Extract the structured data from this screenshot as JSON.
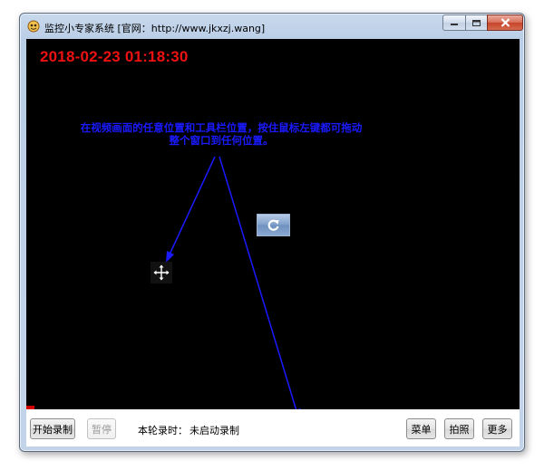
{
  "window": {
    "title": "监控小专家系统 [官网：http://www.jkxzj.wang]",
    "icon": "app-logo-icon",
    "controls": {
      "minimize_icon": "minimize-icon",
      "maximize_icon": "maximize-icon",
      "close_icon": "close-icon"
    }
  },
  "video": {
    "timestamp": "2018-02-23 01:18:30",
    "instruction": "在视频画面的任意位置和工具栏位置，按住鼠标左键都可拖动整个窗口到任何位置。",
    "center_button_icon": "refresh-icon",
    "cursor_icon": "move-icon"
  },
  "toolbar": {
    "start_record_label": "开始录制",
    "pause_label": "暂停",
    "record_time_label": "本轮录时：",
    "record_time_value": "未启动录制",
    "menu_label": "菜单",
    "snapshot_label": "拍照",
    "more_label": "更多"
  },
  "colors": {
    "timestamp": "#ee1111",
    "instruction": "#1a1aff",
    "video_background": "#000000"
  }
}
